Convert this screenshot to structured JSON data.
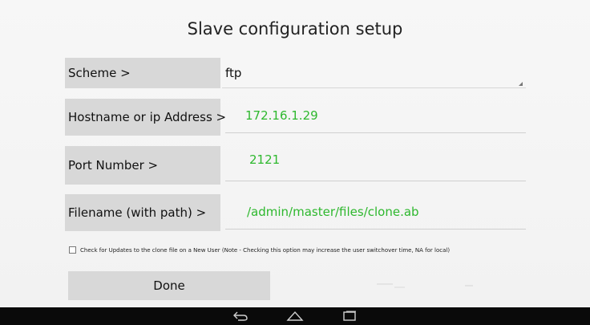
{
  "page": {
    "title": "Slave configuration setup"
  },
  "fields": {
    "scheme": {
      "label": "Scheme >",
      "value": "ftp"
    },
    "hostname": {
      "label": "Hostname or ip Address >",
      "value": "172.16.1.29"
    },
    "port": {
      "label": "Port Number >",
      "value": "2121"
    },
    "filename": {
      "label": "Filename (with path) >",
      "value": "/admin/master/files/clone.ab"
    }
  },
  "options": {
    "check_updates_label": "Check for Updates to the clone file on a New User (Note - Checking this option may increase the user switchover time, NA for local)",
    "check_updates_checked": false
  },
  "actions": {
    "done_label": "Done"
  },
  "navbar": {
    "icons": [
      "back-icon",
      "home-icon",
      "recent-apps-icon"
    ]
  },
  "colors": {
    "value_text": "#2eb82e",
    "label_background": "#d8d8d8",
    "navbar_background": "#0a0a0a"
  }
}
